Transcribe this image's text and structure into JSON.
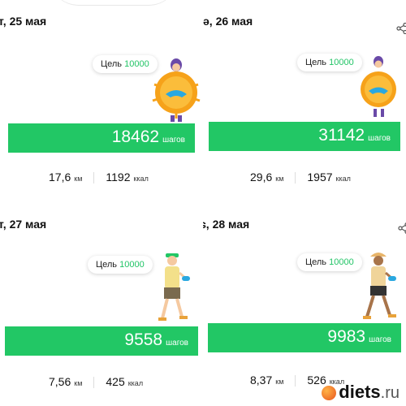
{
  "cards": [
    {
      "date": "т, 25 мая",
      "goal_label": "Цель",
      "goal_value": "10000",
      "steps": "18462",
      "steps_unit": "шагов",
      "distance": "17,6",
      "distance_unit": "км",
      "calories": "1192",
      "calories_unit": "ккал",
      "badge": "orange-sun-badge"
    },
    {
      "date": "ə, 26 мая",
      "goal_label": "Цель",
      "goal_value": "10000",
      "steps": "31142",
      "steps_unit": "шагов",
      "distance": "29,6",
      "distance_unit": "км",
      "calories": "1957",
      "calories_unit": "ккал",
      "badge": "orange-sun-badge"
    },
    {
      "date": "т, 27 мая",
      "goal_label": "Цель",
      "goal_value": "10000",
      "steps": "9558",
      "steps_unit": "шагов",
      "distance": "7,56",
      "distance_unit": "км",
      "calories": "425",
      "calories_unit": "ккал",
      "badge": "walking-person"
    },
    {
      "date": "ɕ, 28 мая",
      "goal_label": "Цель",
      "goal_value": "10000",
      "steps": "9983",
      "steps_unit": "шагов",
      "distance": "8,37",
      "distance_unit": "км",
      "calories": "526",
      "calories_unit": "ккал",
      "badge": "walking-person"
    }
  ],
  "watermark": {
    "text": "diets",
    "suffix": ".ru"
  },
  "colors": {
    "accent_green": "#22c765",
    "goal_green": "#21c466",
    "badge_orange": "#f6a21a"
  }
}
